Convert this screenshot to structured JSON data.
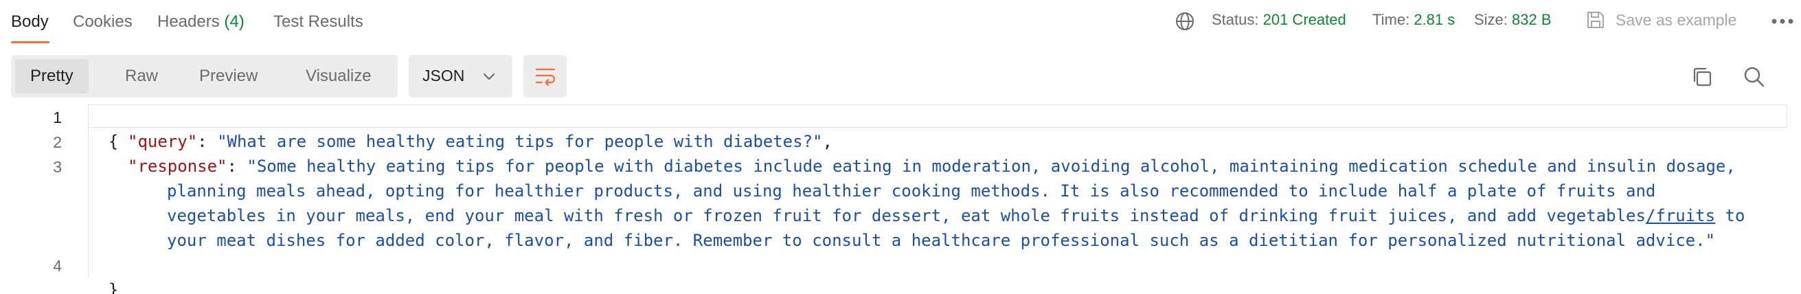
{
  "tabs": [
    {
      "label": "Body"
    },
    {
      "label": "Cookies"
    },
    {
      "label": "Headers",
      "count": "(4)"
    },
    {
      "label": "Test Results"
    }
  ],
  "status": {
    "status_label": "Status:",
    "status_value": "201 Created",
    "time_label": "Time:",
    "time_value": "2.81 s",
    "size_label": "Size:",
    "size_value": "832 B",
    "save_label": "Save as example"
  },
  "icons": {
    "globe": "globe-icon",
    "save": "save-icon",
    "more": "more-horizontal-icon",
    "chevron": "chevron-down-icon",
    "wrap": "wrap-lines-icon",
    "copy": "copy-icon",
    "search": "search-icon"
  },
  "view_modes": [
    "Pretty",
    "Raw",
    "Preview",
    "Visualize"
  ],
  "format": {
    "selected": "JSON"
  },
  "code": {
    "line_numbers": [
      "1",
      "2",
      "3",
      "4"
    ],
    "open_brace": "{",
    "close_brace": "}",
    "query_key": "\"query\"",
    "query_value": "\"What are some healthy eating tips for people with diabetes?\"",
    "response_key": "\"response\"",
    "response_line1": "\"Some healthy eating tips for people with diabetes include eating in moderation, avoiding alcohol, maintaining medication schedule and insulin dosage,",
    "response_line2": "planning meals ahead, opting for healthier products, and using healthier cooking methods. It is also recommended to include half a plate of fruits and",
    "response_line3a": "vegetables in your meals, end your meal with fresh or frozen fruit for dessert, eat whole fruits instead of drinking fruit juices, and add vegetables",
    "response_line3b": "/fruits",
    "response_line3c": " to",
    "response_line4": "your meat dishes for added color, flavor, and fiber. Remember to consult a healthcare professional such as a dietitian for personalized nutritional advice.\""
  },
  "colors": {
    "accent": "#ff6c37",
    "success": "#0a8a33",
    "json_key": "#a31515",
    "json_string": "#1d4fa3"
  }
}
